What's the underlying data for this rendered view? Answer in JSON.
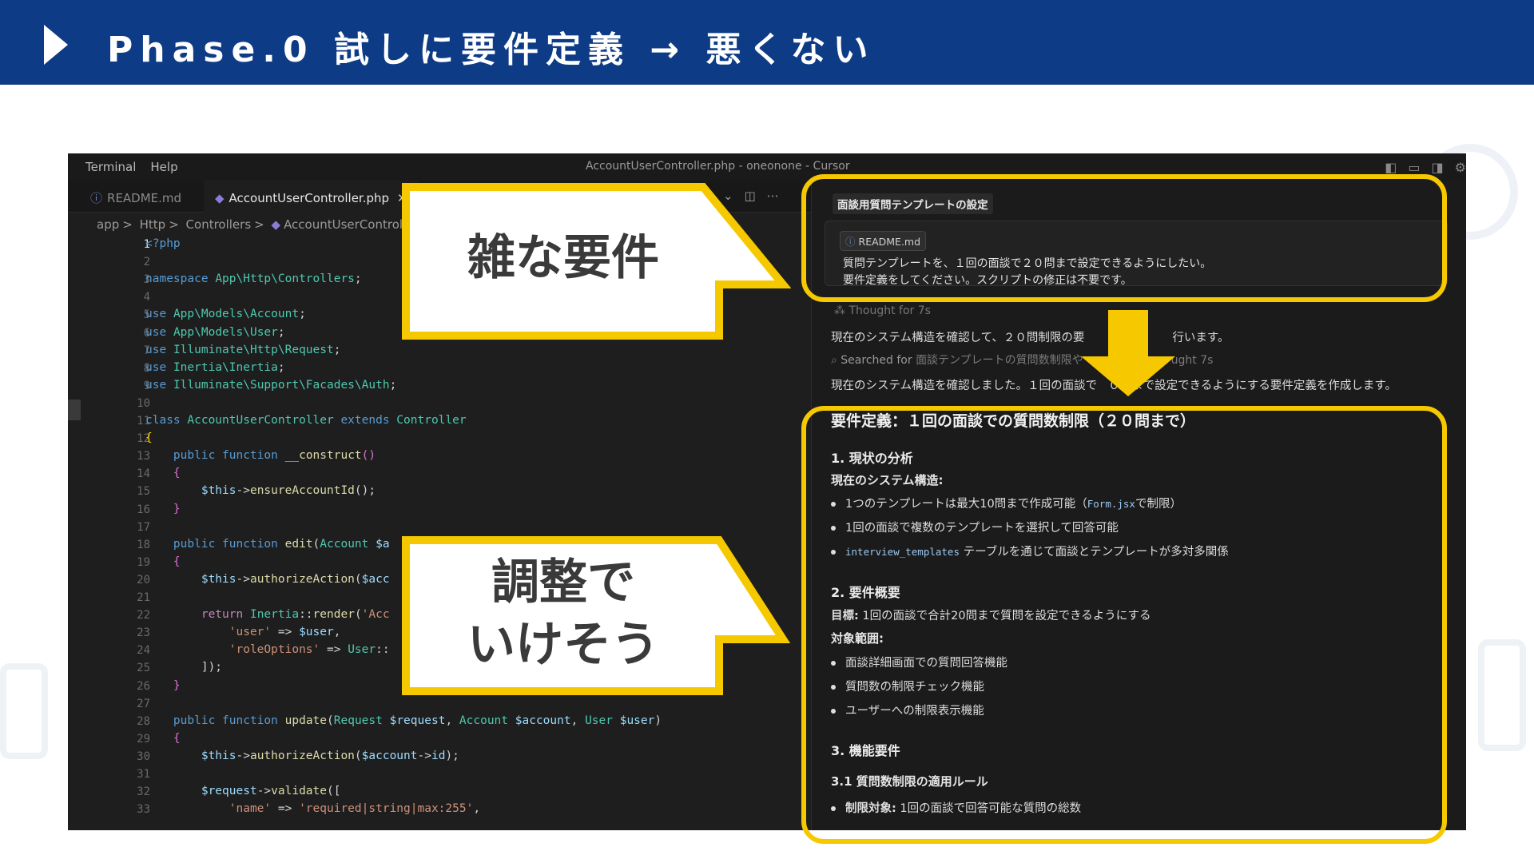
{
  "header": {
    "title": "Phase.0 試しに要件定義 → 悪くない"
  },
  "window": {
    "menu": [
      "Terminal",
      "Help"
    ],
    "title": "AccountUserController.php - oneonone - Cursor"
  },
  "tabs": [
    {
      "label": "README.md",
      "active": false
    },
    {
      "label": "AccountUserController.php",
      "active": true
    }
  ],
  "breadcrumb": [
    "app",
    "Http",
    "Controllers",
    "AccountUserController.php"
  ],
  "code_lines": [
    {
      "n": "1",
      "html": "<span class=\"k\">&lt;?php</span>"
    },
    {
      "n": "2",
      "html": ""
    },
    {
      "n": "3",
      "html": "<span class=\"k\">namespace</span> <span class=\"t\">App\\Http\\Controllers</span>;"
    },
    {
      "n": "4",
      "html": ""
    },
    {
      "n": "5",
      "html": "<span class=\"k\">use</span> <span class=\"t\">App\\Models\\Account</span>;"
    },
    {
      "n": "6",
      "html": "<span class=\"k\">use</span> <span class=\"t\">App\\Models\\User</span>;"
    },
    {
      "n": "7",
      "html": "<span class=\"k\">use</span> <span class=\"t\">Illuminate\\Http\\Request</span>;"
    },
    {
      "n": "8",
      "html": "<span class=\"k\">use</span> <span class=\"t\">Inertia\\Inertia</span>;"
    },
    {
      "n": "9",
      "html": "<span class=\"k\">use</span> <span class=\"t\">Illuminate\\Support\\Facades\\Auth</span>;"
    },
    {
      "n": "10",
      "html": ""
    },
    {
      "n": "11",
      "html": "<span class=\"k\">class</span> <span class=\"t\">AccountUserController</span> <span class=\"k\">extends</span> <span class=\"t\">Controller</span>"
    },
    {
      "n": "12",
      "html": "<span class=\"p\">{</span>"
    },
    {
      "n": "13",
      "html": "    <span class=\"k\">public</span> <span class=\"k\">function</span> <span class=\"f\">__construct</span><span class=\"pp\">()</span>"
    },
    {
      "n": "14",
      "html": "    <span class=\"pp\">{</span>"
    },
    {
      "n": "15",
      "html": "        <span class=\"v\">$this</span>-&gt;<span class=\"f\">ensureAccountId</span>();"
    },
    {
      "n": "16",
      "html": "    <span class=\"pp\">}</span>"
    },
    {
      "n": "17",
      "html": ""
    },
    {
      "n": "18",
      "html": "    <span class=\"k\">public</span> <span class=\"k\">function</span> <span class=\"f\">edit</span>(<span class=\"t\">Account</span> <span class=\"v\">$a</span>"
    },
    {
      "n": "19",
      "html": "    <span class=\"pp\">{</span>"
    },
    {
      "n": "20",
      "html": "        <span class=\"v\">$this</span>-&gt;<span class=\"f\">authorizeAction</span>(<span class=\"v\">$acc</span>"
    },
    {
      "n": "21",
      "html": ""
    },
    {
      "n": "22",
      "html": "        <span class=\"kc\">return</span> <span class=\"t\">Inertia</span>::<span class=\"f\">render</span>(<span class=\"s\">'Acc</span>"
    },
    {
      "n": "23",
      "html": "            <span class=\"s\">'user'</span> =&gt; <span class=\"v\">$user</span>,"
    },
    {
      "n": "24",
      "html": "            <span class=\"s\">'roleOptions'</span> =&gt; <span class=\"t\">User</span>::"
    },
    {
      "n": "25",
      "html": "        ]);"
    },
    {
      "n": "26",
      "html": "    <span class=\"pp\">}</span>"
    },
    {
      "n": "27",
      "html": ""
    },
    {
      "n": "28",
      "html": "    <span class=\"k\">public</span> <span class=\"k\">function</span> <span class=\"f\">update</span>(<span class=\"t\">Request</span> <span class=\"v\">$request</span>, <span class=\"t\">Account</span> <span class=\"v\">$account</span>, <span class=\"t\">User</span> <span class=\"v\">$user</span>)"
    },
    {
      "n": "29",
      "html": "    <span class=\"pp\">{</span>"
    },
    {
      "n": "30",
      "html": "        <span class=\"v\">$this</span>-&gt;<span class=\"f\">authorizeAction</span>(<span class=\"v\">$account</span>-&gt;<span class=\"v\">id</span>);"
    },
    {
      "n": "31",
      "html": ""
    },
    {
      "n": "32",
      "html": "        <span class=\"v\">$request</span>-&gt;<span class=\"f\">validate</span>(["
    },
    {
      "n": "33",
      "html": "            <span class=\"s\">'name'</span> =&gt; <span class=\"s\">'required|string|max:255'</span>,"
    }
  ],
  "chat": {
    "title": "面談用質問テンプレートの設定",
    "chip": "README.md",
    "request_lines": [
      "質問テンプレートを、１回の面談で２０問まで設定できるようにしたい。",
      "要件定義をしてください。スクリプトの修正は不要です。"
    ],
    "thought": "Thought for 7s",
    "status1": "現在のシステム構造を確認して、２０問制限の要",
    "status1_tail": "行います。",
    "search_label": "Searched for",
    "search_query": "面談テンプレートの質問数制限や",
    "search_tail": "ught 7s",
    "status2": "現在のシステム構造を確認しました。１回の面談で",
    "status2_tail": "０問まで設定できるようにする要件定義を作成します。"
  },
  "response": {
    "h1": "要件定義：１回の面談での質問数制限（２０問まで）",
    "s1_title": "1. 現状の分析",
    "s1_sub": "現在のシステム構造:",
    "s1_b1_a": "1つのテンプレートは最大10問まで作成可能（",
    "s1_b1_code": "Form.jsx",
    "s1_b1_b": "で制限）",
    "s1_b2": "1回の面談で複数のテンプレートを選択して回答可能",
    "s1_b3_code": "interview_templates",
    "s1_b3_b": "テーブルを通じて面談とテンプレートが多対多関係",
    "s2_title": "2. 要件概要",
    "s2_goal_label": "目標:",
    "s2_goal": "1回の面談で合計20問まで質問を設定できるようにする",
    "s2_scope": "対象範囲:",
    "s2_b1": "面談詳細画面での質問回答機能",
    "s2_b2": "質問数の制限チェック機能",
    "s2_b3": "ユーザーへの制限表示機能",
    "s3_title": "3. 機能要件",
    "s31_title": "3.1 質問数制限の適用ルール",
    "s31_b1_label": "制限対象:",
    "s31_b1": "1回の面談で回答可能な質問の総数"
  },
  "callouts": {
    "top": "雑な要件",
    "bottom_l1": "調整で",
    "bottom_l2": "いけそう"
  },
  "colors": {
    "header": "#0d3b86",
    "highlight": "#f5c800"
  }
}
